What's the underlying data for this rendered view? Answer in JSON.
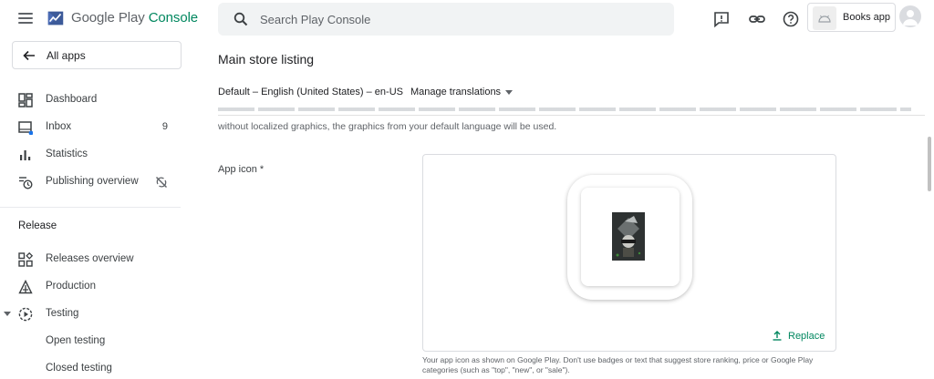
{
  "brand": {
    "name_part1": "Google Play",
    "name_part2": "Console"
  },
  "sidebar": {
    "all_apps": "All apps",
    "items": [
      {
        "label": "Dashboard",
        "icon": "dashboard-icon"
      },
      {
        "label": "Inbox",
        "icon": "inbox-icon",
        "badge": "9"
      },
      {
        "label": "Statistics",
        "icon": "bar-chart-icon"
      },
      {
        "label": "Publishing overview",
        "icon": "schedule-icon",
        "trailing_icon": "sync-disabled-icon"
      }
    ],
    "release_section": "Release",
    "release_items": [
      {
        "label": "Releases overview",
        "icon": "releases-icon"
      },
      {
        "label": "Production",
        "icon": "production-icon"
      },
      {
        "label": "Testing",
        "icon": "play-circle-icon",
        "expanded": true
      },
      {
        "label": "Open testing"
      },
      {
        "label": "Closed testing"
      }
    ]
  },
  "topbar": {
    "search_placeholder": "Search Play Console",
    "app_name": "Books app",
    "icons": [
      "feedback-icon",
      "link-icon",
      "help-icon"
    ]
  },
  "main": {
    "title": "Main store listing",
    "language": "Default – English (United States) – en-US",
    "manage_translations": "Manage translations",
    "intro_text": "without localized graphics, the graphics from your default language will be used.",
    "app_icon_label": "App icon  *",
    "replace_label": "Replace",
    "helper_text": "Your app icon as shown on Google Play. Don't use badges or text that suggest store ranking, price or Google Play categories (such as \"top\", \"new\", or \"sale\")."
  },
  "colors": {
    "accent": "#01875f",
    "text": "#202124",
    "muted": "#5f6368",
    "border": "#dadce0"
  }
}
